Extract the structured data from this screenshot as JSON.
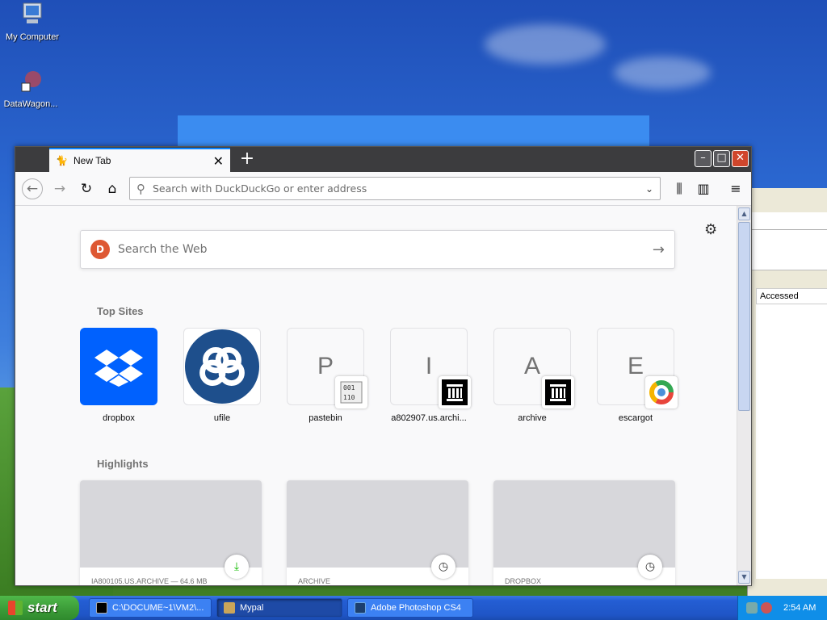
{
  "desktop": {
    "icons": [
      {
        "label": "My Computer"
      },
      {
        "label": "DataWagon..."
      }
    ]
  },
  "background_window": {
    "column_header": "Accessed"
  },
  "browser": {
    "tab": {
      "title": "New Tab"
    },
    "urlbar": {
      "placeholder": "Search with DuckDuckGo or enter address"
    },
    "search": {
      "placeholder": "Search the Web"
    },
    "top_sites": {
      "title": "Top Sites",
      "items": [
        {
          "label": "dropbox",
          "letter": ""
        },
        {
          "label": "ufile",
          "letter": ""
        },
        {
          "label": "pastebin",
          "letter": "P"
        },
        {
          "label": "a802907.us.archi...",
          "letter": "I"
        },
        {
          "label": "archive",
          "letter": "A"
        },
        {
          "label": "escargot",
          "letter": "E"
        }
      ]
    },
    "highlights": {
      "title": "Highlights",
      "items": [
        {
          "source": "IA800105.US.ARCHIVE — 64.6 MB",
          "icon": "download-icon"
        },
        {
          "source": "ARCHIVE",
          "icon": "clock-icon"
        },
        {
          "source": "DROPBOX",
          "icon": "clock-icon"
        }
      ]
    }
  },
  "taskbar": {
    "start_label": "start",
    "items": [
      {
        "label": "C:\\DOCUME~1\\VM2\\..."
      },
      {
        "label": "Mypal"
      },
      {
        "label": "Adobe Photoshop CS4"
      }
    ],
    "clock": "2:54 AM"
  }
}
